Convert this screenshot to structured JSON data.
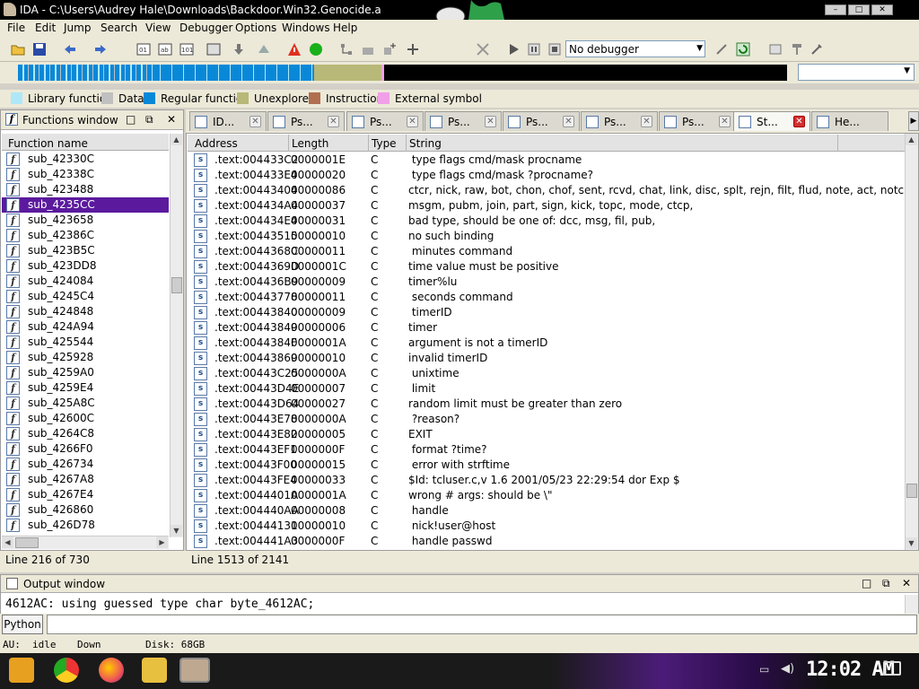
{
  "window": {
    "title": "IDA - C:\\Users\\Audrey Hale\\Downloads\\Backdoor.Win32.Genocide.a",
    "min": "–",
    "max": "□",
    "close": "✕"
  },
  "menu": [
    "File",
    "Edit",
    "Jump",
    "Search",
    "View",
    "Debugger",
    "Options",
    "Windows",
    "Help"
  ],
  "toolbar": {
    "debugger_select": "No debugger"
  },
  "legend": [
    {
      "label": "Library function",
      "color": "#aee8f8"
    },
    {
      "label": "Data",
      "color": "#c0c0c0"
    },
    {
      "label": "Regular function",
      "color": "#0a88d8"
    },
    {
      "label": "Unexplored",
      "color": "#b8b878"
    },
    {
      "label": "Instruction",
      "color": "#b07050"
    },
    {
      "label": "External symbol",
      "color": "#f0a0e8"
    }
  ],
  "functions_window": {
    "title": "Functions window",
    "column": "Function name",
    "items": [
      "sub_42330C",
      "sub_42338C",
      "sub_423488",
      "sub_4235CC",
      "sub_423658",
      "sub_42386C",
      "sub_423B5C",
      "sub_423DD8",
      "sub_424084",
      "sub_4245C4",
      "sub_424848",
      "sub_424A94",
      "sub_425544",
      "sub_425928",
      "sub_4259A0",
      "sub_4259E4",
      "sub_425A8C",
      "sub_42600C",
      "sub_4264C8",
      "sub_4266F0",
      "sub_426734",
      "sub_4267A8",
      "sub_4267E4",
      "sub_426860",
      "sub_426D78"
    ],
    "selected_index": 3,
    "status": "Line 216 of 730"
  },
  "tabs": [
    {
      "label": "ID..."
    },
    {
      "label": "Ps..."
    },
    {
      "label": "Ps..."
    },
    {
      "label": "Ps..."
    },
    {
      "label": "Ps..."
    },
    {
      "label": "Ps..."
    },
    {
      "label": "Ps..."
    },
    {
      "label": "St..."
    },
    {
      "label": "He..."
    }
  ],
  "active_tab_index": 7,
  "strings_window": {
    "columns": [
      "Address",
      "Length",
      "Type",
      "String"
    ],
    "rows": [
      [
        ".text:004433C2",
        "0000001E",
        "C",
        " type flags cmd/mask procname"
      ],
      [
        ".text:004433E4",
        "00000020",
        "C",
        " type flags cmd/mask ?procname?"
      ],
      [
        ".text:00443404",
        "00000086",
        "C",
        "ctcr, nick, raw, bot, chon, chof, sent, rcvd, chat, link, disc, splt, rejn, filt, flud, note, act, notc, wall..."
      ],
      [
        ".text:004434A4",
        "00000037",
        "C",
        "msgm, pubm, join, part, sign, kick, topc, mode, ctcp,"
      ],
      [
        ".text:004434E4",
        "00000031",
        "C",
        "bad type, should be one of: dcc, msg, fil, pub,"
      ],
      [
        ".text:00443515",
        "00000010",
        "C",
        "no such binding"
      ],
      [
        ".text:0044368C",
        "00000011",
        "C",
        " minutes command"
      ],
      [
        ".text:0044369D",
        "0000001C",
        "C",
        "time value must be positive"
      ],
      [
        ".text:004436B9",
        "00000009",
        "C",
        "timer%lu"
      ],
      [
        ".text:00443778",
        "00000011",
        "C",
        " seconds command"
      ],
      [
        ".text:00443840",
        "00000009",
        "C",
        " timerID"
      ],
      [
        ".text:00443849",
        "00000006",
        "C",
        "timer"
      ],
      [
        ".text:0044384F",
        "0000001A",
        "C",
        "argument is not a timerID"
      ],
      [
        ".text:00443869",
        "00000010",
        "C",
        "invalid timerID"
      ],
      [
        ".text:00443C25",
        "0000000A",
        "C",
        " unixtime"
      ],
      [
        ".text:00443D4E",
        "00000007",
        "C",
        " limit"
      ],
      [
        ".text:00443D64",
        "00000027",
        "C",
        "random limit must be greater than zero"
      ],
      [
        ".text:00443E78",
        "0000000A",
        "C",
        " ?reason?"
      ],
      [
        ".text:00443E82",
        "00000005",
        "C",
        "EXIT"
      ],
      [
        ".text:00443EF1",
        "0000000F",
        "C",
        " format ?time?"
      ],
      [
        ".text:00443F00",
        "00000015",
        "C",
        " error with strftime"
      ],
      [
        ".text:00443FE4",
        "00000033",
        "C",
        "$Id: tcluser.c,v 1.6 2001/05/23 22:29:54 dor Exp $"
      ],
      [
        ".text:0044401A",
        "0000001A",
        "C",
        "wrong # args: should be \\\""
      ],
      [
        ".text:004440AA",
        "00000008",
        "C",
        " handle"
      ],
      [
        ".text:00444131",
        "00000010",
        "C",
        " nick!user@host"
      ],
      [
        ".text:004441A3",
        "0000000F",
        "C",
        " handle passwd"
      ]
    ],
    "status": "Line 1513 of 2141"
  },
  "output_window": {
    "title": "Output window",
    "text": "4612AC: using guessed type char byte_4612AC;"
  },
  "python_button": "Python",
  "bottom_status": {
    "au": "AU:",
    "state": "idle",
    "dir": "Down",
    "disk": "Disk: 68GB"
  },
  "taskbar": {
    "clock": "12:02 AM"
  }
}
